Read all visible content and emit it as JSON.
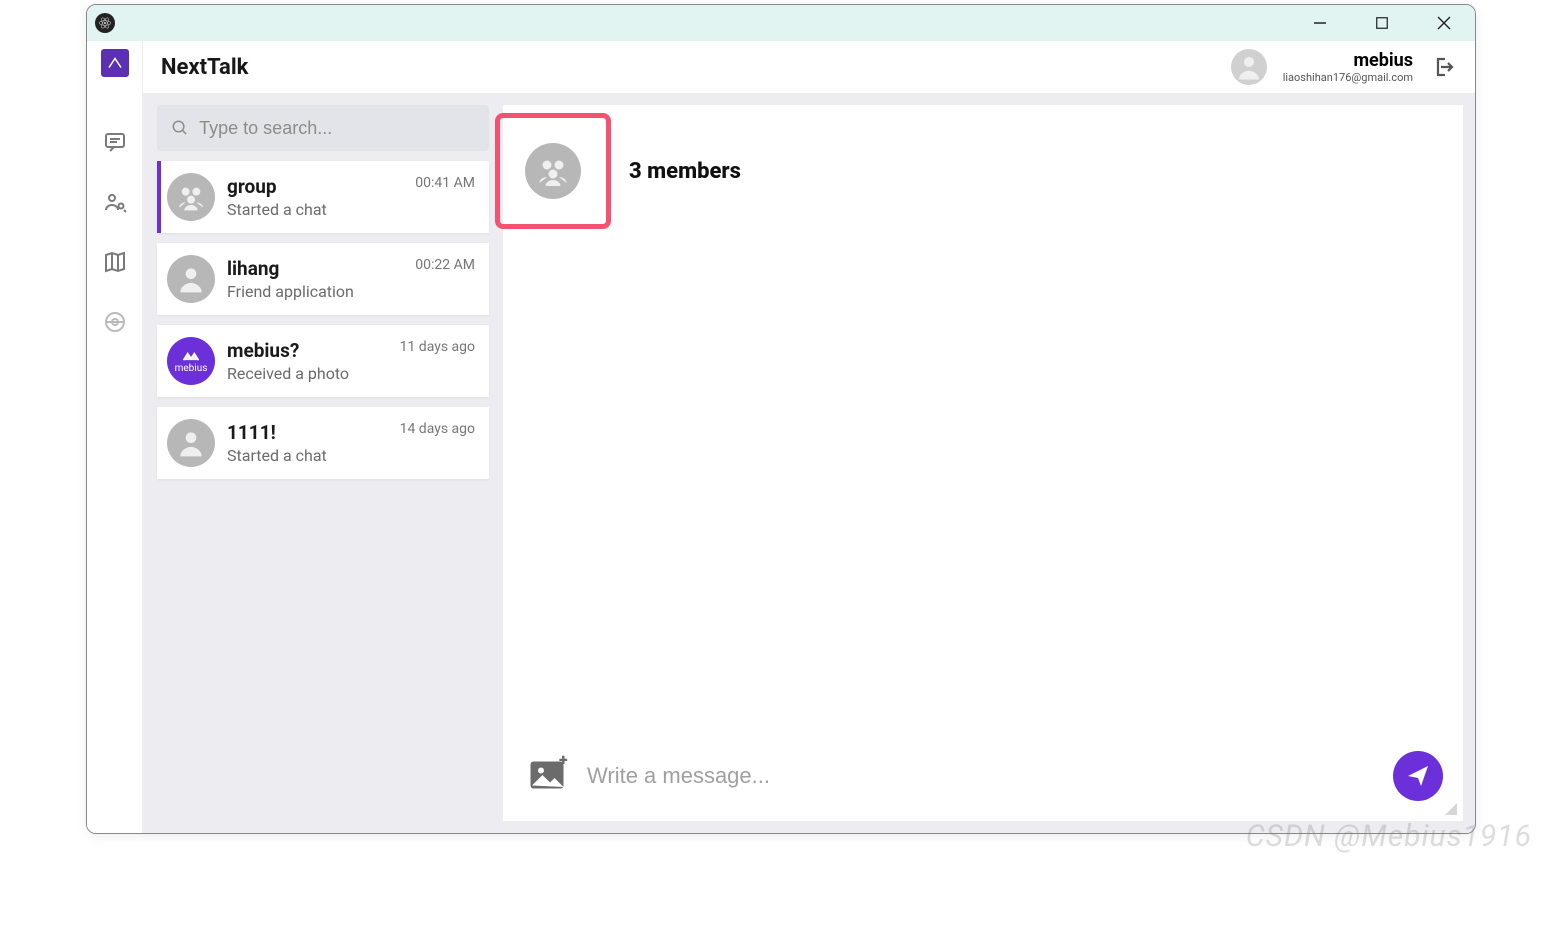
{
  "app_name": "NextTalk",
  "user": {
    "name": "mebius",
    "email": "liaoshihan176@gmail.com"
  },
  "search": {
    "placeholder": "Type to search..."
  },
  "chats": [
    {
      "title": "group",
      "subtitle": "Started a chat",
      "time": "00:41 AM",
      "active": true,
      "avatar": "group"
    },
    {
      "title": "lihang",
      "subtitle": "Friend application",
      "time": "00:22 AM",
      "active": false,
      "avatar": "person"
    },
    {
      "title": "mebius?",
      "subtitle": "Received a photo",
      "time": "11 days ago",
      "active": false,
      "avatar": "purple"
    },
    {
      "title": "1111!",
      "subtitle": "Started a chat",
      "time": "14 days ago",
      "active": false,
      "avatar": "person"
    }
  ],
  "conversation": {
    "title": "3 members",
    "composer_placeholder": "Write a message..."
  },
  "purple_avatar_text": "mebius",
  "watermark": "CSDN @Mebius1916"
}
